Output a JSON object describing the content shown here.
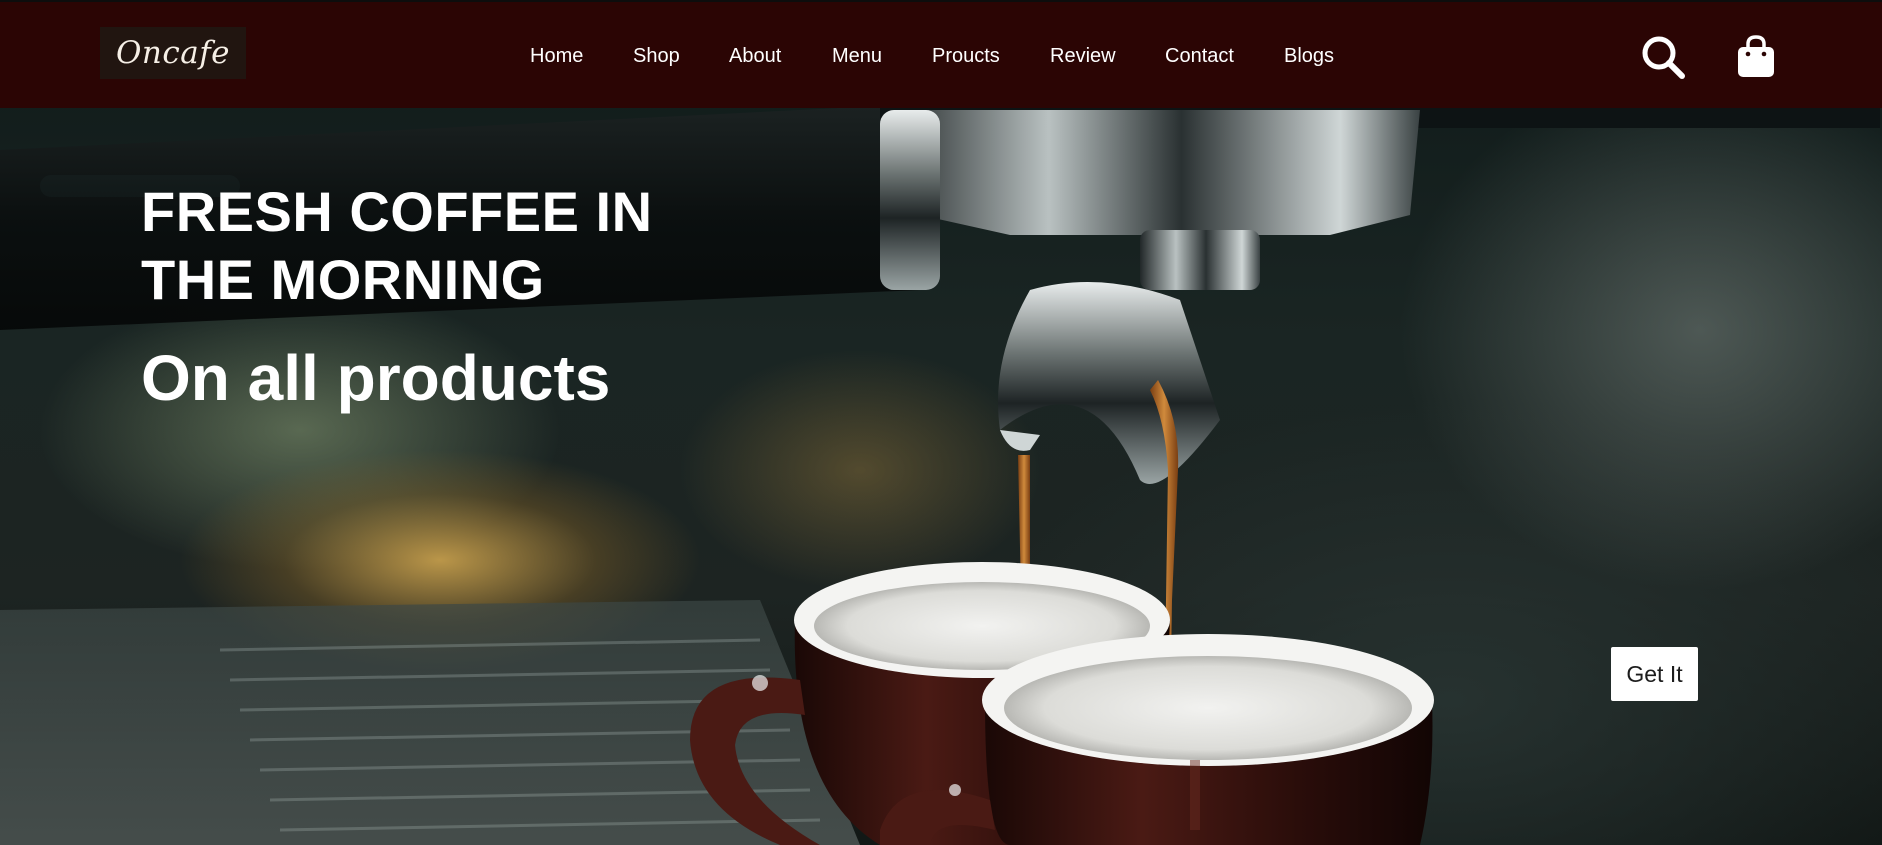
{
  "brand": {
    "logo_text": "Oncafe"
  },
  "nav": {
    "items": [
      {
        "label": "Home"
      },
      {
        "label": "Shop"
      },
      {
        "label": "About"
      },
      {
        "label": "Menu"
      },
      {
        "label": "Proucts"
      },
      {
        "label": "Review"
      },
      {
        "label": "Contact"
      },
      {
        "label": "Blogs"
      }
    ],
    "icons": [
      "search-icon",
      "shopping-bag-icon"
    ]
  },
  "hero": {
    "headline": "FRESH COFFEE IN THE MORNING",
    "subheadline": "On all products",
    "cta_label": "Get It",
    "background": "espresso-machine-pouring-coffee-photo"
  },
  "colors": {
    "navbar": "#2b0504",
    "logo_bg": "#211510",
    "text": "#ffffff",
    "coffee": "#b8732c",
    "cup": "#3a1612"
  }
}
